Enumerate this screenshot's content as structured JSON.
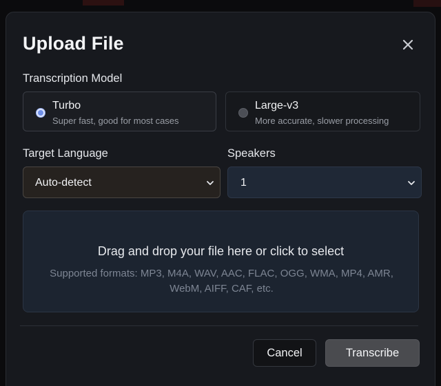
{
  "dialog": {
    "title": "Upload File",
    "close_icon": "close-icon"
  },
  "model": {
    "label": "Transcription Model",
    "options": [
      {
        "name": "Turbo",
        "description": "Super fast, good for most cases",
        "selected": true
      },
      {
        "name": "Large-v3",
        "description": "More accurate, slower processing",
        "selected": false
      }
    ]
  },
  "language": {
    "label": "Target Language",
    "value": "Auto-detect"
  },
  "speakers": {
    "label": "Speakers",
    "value": "1"
  },
  "dropzone": {
    "main_text": "Drag and drop your file here or click to select",
    "supported_text": "Supported formats: MP3, M4A, WAV, AAC, FLAC, OGG, WMA, MP4, AMR, WebM, AIFF, CAF, etc."
  },
  "footer": {
    "cancel_label": "Cancel",
    "transcribe_label": "Transcribe"
  },
  "colors": {
    "accent": "#6f8fe8",
    "modal_bg": "#17191e",
    "dropzone_bg": "#1c2430"
  }
}
